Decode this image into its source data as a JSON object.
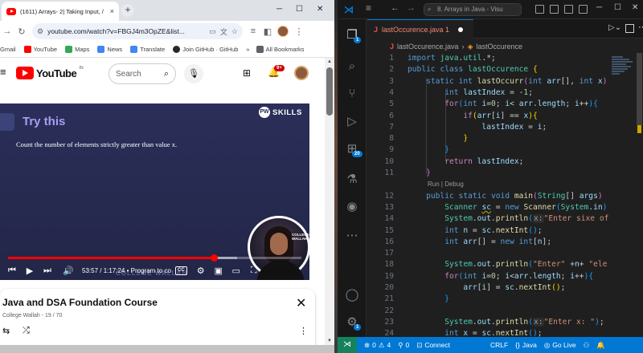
{
  "browser": {
    "tab_title": "(1611) Arrays- 2| Taking Input, /",
    "tab_close": "×",
    "new_tab": "+",
    "win_min": "─",
    "win_max": "☐",
    "win_close": "✕",
    "url": "youtube.com/watch?v=FBGJ4m3OpZE&list...",
    "bookmarks": [
      {
        "label": "Gmail",
        "color": "#ea4335"
      },
      {
        "label": "YouTube",
        "color": "#ff0000"
      },
      {
        "label": "Maps",
        "color": "#34a853"
      },
      {
        "label": "News",
        "color": "#4285f4"
      },
      {
        "label": "Translate",
        "color": "#4285f4"
      },
      {
        "label": "Join GitHub · GitHub",
        "color": "#24292f"
      }
    ],
    "bookmarks_overflow": "»",
    "all_bookmarks": "All Bookmarks"
  },
  "youtube": {
    "logo": "YouTube",
    "country": "IN",
    "search_placeholder": "Search",
    "notifications": "9+",
    "video": {
      "heading": "Try this",
      "question": "Count the number of elements strictly greater than value x.",
      "brand": "SKILLS",
      "presenter_mark": "COLLEGE WALLAH",
      "watermark": "COLLEGE WALLAH",
      "progress": 0.7,
      "buffered": 0.78,
      "time": "53:57 / 1:17:24",
      "chapter": "• Program to co",
      "cc": "CC"
    },
    "playlist": {
      "title": "Java and DSA Foundation Course",
      "subtitle": "College Wallah - 19 / 70"
    }
  },
  "vscode": {
    "search": "8. Arrays in Java - Visu",
    "tab": {
      "icon": "J",
      "label": "lastOccurence.java 1"
    },
    "breadcrumb": {
      "file": "lastOccurence.java",
      "sep": "›",
      "symbol": "lastOccurence"
    },
    "codelens": "Run | Debug",
    "badges": {
      "explorer": "1",
      "extensions": "20",
      "accounts": "1"
    },
    "status": {
      "errors": "0",
      "warnings": "4",
      "ports": "0",
      "connect": "Connect",
      "eol": "CRLF",
      "lang": "Java",
      "golive": "Go Live"
    }
  }
}
